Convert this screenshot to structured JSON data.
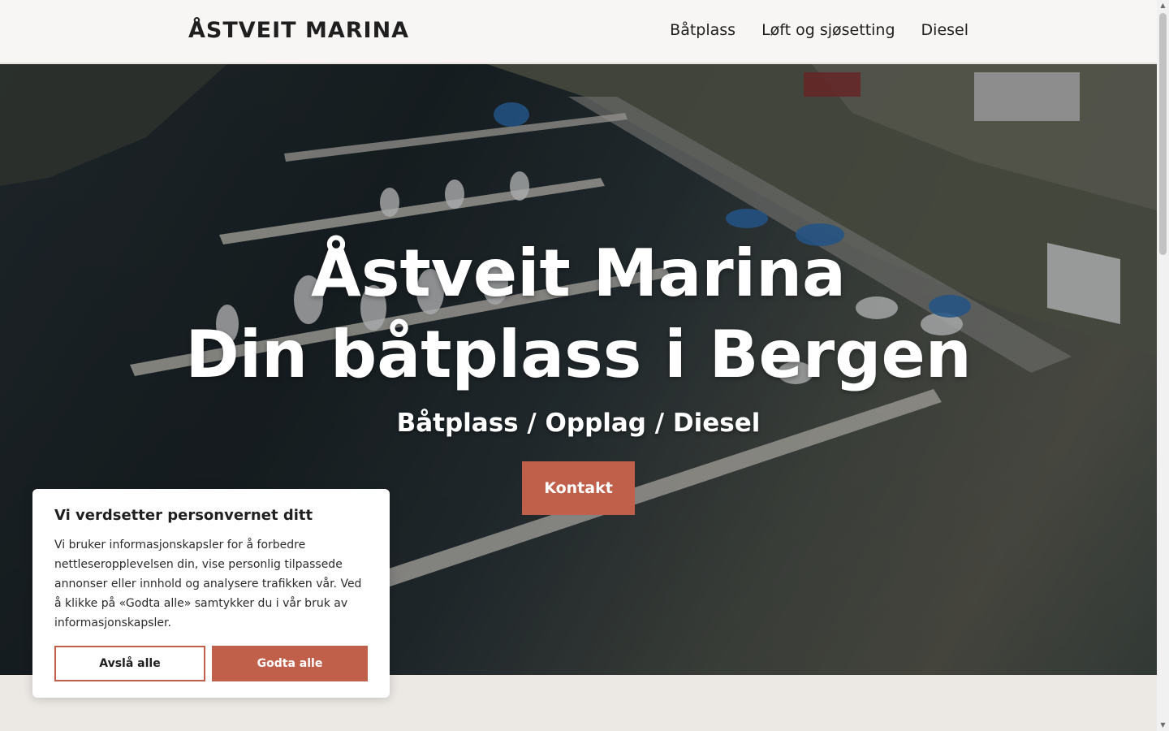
{
  "header": {
    "logo": "ÅSTVEIT MARINA",
    "nav": [
      "Båtplass",
      "Løft og sjøsetting",
      "Diesel"
    ]
  },
  "hero": {
    "title_line1": "Åstveit Marina",
    "title_line2": "Din båtplass i Bergen",
    "subtitle": "Båtplass / Opplag / Diesel",
    "cta": "Kontakt"
  },
  "cookie": {
    "title": "Vi verdsetter personvernet ditt",
    "text": "Vi bruker informasjonskapsler for å forbedre nettleseropplevelsen din, vise personlig tilpassede annonser eller innhold og analysere trafikken vår. Ved å klikke på «Godta alle» samtykker du i vår bruk av informasjonskapsler.",
    "reject": "Avslå alle",
    "accept": "Godta alle"
  },
  "colors": {
    "accent": "#c0604a",
    "header_bg": "#f7f6f4",
    "section_bg": "#ece9e5"
  }
}
